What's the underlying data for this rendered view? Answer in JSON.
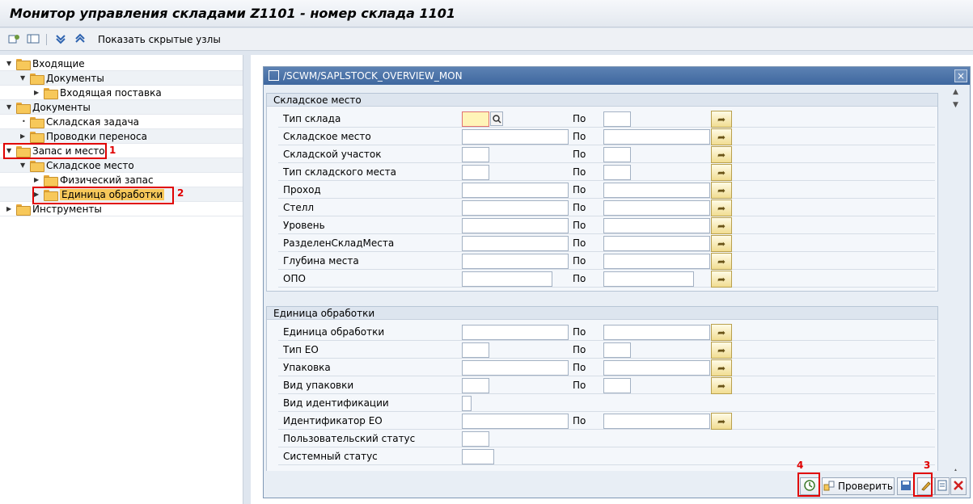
{
  "title": "Монитор управления складами Z1101 - номер склада 1101",
  "toolbar": {
    "icons": [
      "settings-icon",
      "layout-icon",
      "collapse-icon",
      "expand-icon"
    ],
    "show_hidden": "Показать скрытые узлы"
  },
  "tree": [
    {
      "label": "Входящие",
      "level": 0,
      "expanded": true
    },
    {
      "label": "Документы",
      "level": 1,
      "expanded": true
    },
    {
      "label": "Входящая поставка",
      "level": 2,
      "expanded": false
    },
    {
      "label": "Документы",
      "level": 0,
      "expanded": true
    },
    {
      "label": "Складская задача",
      "level": 1,
      "leaf": true
    },
    {
      "label": "Проводки переноса",
      "level": 1,
      "expanded": false
    },
    {
      "label": "Запас и место",
      "level": 0,
      "expanded": true
    },
    {
      "label": "Складское место",
      "level": 1,
      "expanded": true
    },
    {
      "label": "Физический запас",
      "level": 2,
      "expanded": false
    },
    {
      "label": "Единица обработки",
      "level": 2,
      "expanded": false,
      "selected": true
    },
    {
      "label": "Инструменты",
      "level": 0,
      "expanded": false
    }
  ],
  "markers": {
    "m1": "1",
    "m2": "2",
    "m3": "3",
    "m4": "4"
  },
  "dialog": {
    "title": "/SCWM/SAPLSTOCK_OVERVIEW_MON",
    "close": "×",
    "po_label": "По",
    "group1": {
      "title": "Складское место",
      "rows": [
        {
          "label": "Тип склада"
        },
        {
          "label": "Складское место"
        },
        {
          "label": "Складской участок"
        },
        {
          "label": "Тип складского места"
        },
        {
          "label": "Проход"
        },
        {
          "label": "Стелл"
        },
        {
          "label": "Уровень"
        },
        {
          "label": "РазделенСкладМеста"
        },
        {
          "label": "Глубина места"
        },
        {
          "label": "ОПО"
        }
      ]
    },
    "group2": {
      "title": "Единица обработки",
      "rows": [
        {
          "label": "Единица обработки"
        },
        {
          "label": "Тип ЕО"
        },
        {
          "label": "Упаковка"
        },
        {
          "label": "Вид упаковки"
        },
        {
          "label": "Вид идентификации"
        },
        {
          "label": "Идентификатор ЕО"
        },
        {
          "label": "Пользовательский статус"
        },
        {
          "label": "Системный статус"
        }
      ]
    },
    "buttons": {
      "execute": "execute-icon",
      "check": "Проверить",
      "save": "save-icon",
      "edit": "edit-icon",
      "list": "list-icon",
      "cancel": "cancel-icon"
    }
  },
  "colors": {
    "accent": "#3e679f",
    "highlight": "#e00000",
    "folder": "#f7c85a"
  }
}
